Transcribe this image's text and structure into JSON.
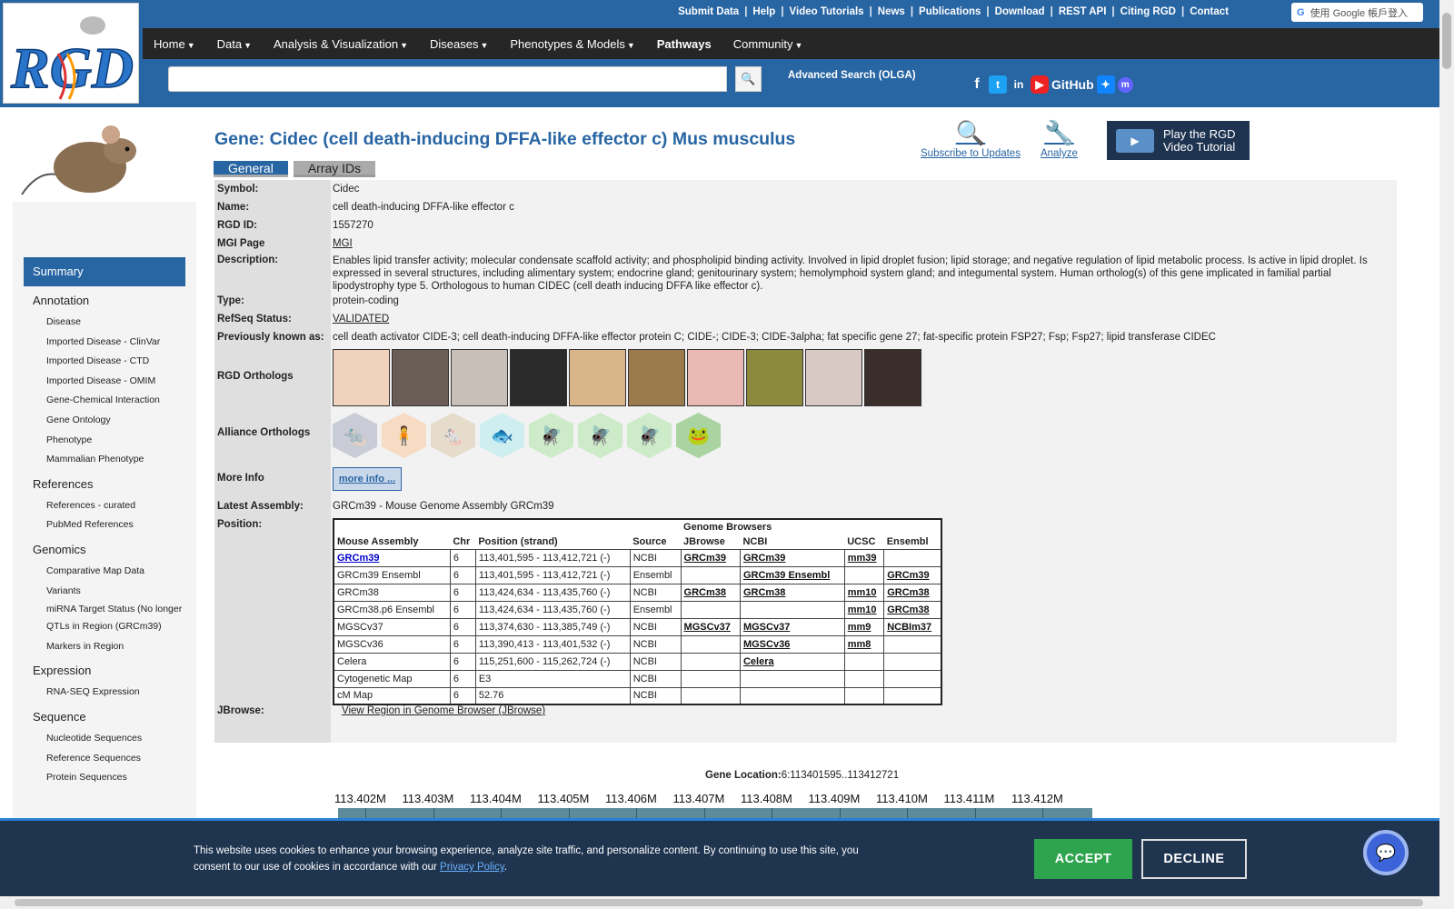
{
  "header": {
    "util_links": [
      "Submit Data",
      "Help",
      "Video Tutorials",
      "News",
      "Publications",
      "Download",
      "REST API",
      "Citing RGD",
      "Contact"
    ],
    "google_signin": "使用 Google 帳戶登入",
    "nav": [
      "Home",
      "Data",
      "Analysis & Visualization",
      "Diseases",
      "Phenotypes & Models",
      "Pathways",
      "Community"
    ],
    "search_placeholder": "",
    "advanced_search": "Advanced Search (OLGA)",
    "social": {
      "github": "GitHub"
    }
  },
  "sidebar": {
    "summary": "Summary",
    "sections": [
      {
        "title": "Annotation",
        "items": [
          "Disease",
          "Imported Disease - ClinVar",
          "Imported Disease - CTD",
          "Imported Disease - OMIM",
          "Gene-Chemical Interaction",
          "Gene Ontology",
          "Phenotype",
          "Mammalian Phenotype"
        ]
      },
      {
        "title": "References",
        "items": [
          "References - curated",
          "PubMed References"
        ]
      },
      {
        "title": "Genomics",
        "items": [
          "Comparative Map Data",
          "Variants",
          "miRNA Target Status (No longer",
          "QTLs in Region (GRCm39)",
          "Markers in Region"
        ]
      },
      {
        "title": "Expression",
        "items": [
          "RNA-SEQ Expression"
        ]
      },
      {
        "title": "Sequence",
        "items": [
          "Nucleotide Sequences",
          "Reference Sequences",
          "Protein Sequences"
        ]
      }
    ]
  },
  "gene": {
    "title": "Gene: Cidec (cell death-inducing DFFA-like effector c) Mus musculus",
    "subscribe": "Subscribe to Updates",
    "analyze": "Analyze",
    "video_line1": "Play the RGD",
    "video_line2": "Video Tutorial",
    "tabs": [
      "General",
      "Array IDs"
    ],
    "labels": {
      "symbol": "Symbol:",
      "name": "Name:",
      "rgd_id": "RGD ID:",
      "mgi": "MGI Page",
      "description": "Description:",
      "type": "Type:",
      "refseq": "RefSeq Status:",
      "prev": "Previously known as:",
      "rgd_orthologs": "RGD Orthologs",
      "alliance": "Alliance Orthologs",
      "more_info": "More Info",
      "latest": "Latest Assembly:",
      "position": "Position:",
      "jbrowse": "JBrowse:"
    },
    "symbol": "Cidec",
    "name": "cell death-inducing DFFA-like effector c",
    "rgd_id": "1557270",
    "mgi": "MGI",
    "description": "Enables lipid transfer activity; molecular condensate scaffold activity; and phospholipid binding activity. Involved in lipid droplet fusion; lipid storage; and negative regulation of lipid metabolic process. Is active in lipid droplet. Is expressed in several structures, including alimentary system; endocrine gland; genitourinary system; hemolymphoid system gland; and integumental system. Human ortholog(s) of this gene implicated in familial partial lipodystrophy type 5. Orthologous to human CIDEC (cell death inducing DFFA like effector c).",
    "type": "protein-coding",
    "refseq": "VALIDATED",
    "prev": "cell death activator CIDE-3; cell death-inducing DFFA-like effector protein C; CIDE-; CIDE-3; CIDE-3alpha; fat specific gene 27; fat-specific protein FSP27; Fsp; Fsp27; lipid transferase CIDEC",
    "more_info_btn": "more info ...",
    "latest": "GRCm39 - Mouse Genome Assembly GRCm39",
    "jbrowse_link": "View Region in Genome Browser (JBrowse)"
  },
  "position_table": {
    "header_group": "Genome Browsers",
    "columns": [
      "Mouse Assembly",
      "Chr",
      "Position (strand)",
      "Source",
      "JBrowse",
      "NCBI",
      "UCSC",
      "Ensembl"
    ],
    "rows": [
      [
        "GRCm39",
        "6",
        "113,401,595 - 113,412,721 (-)",
        "NCBI",
        "GRCm39",
        "GRCm39",
        "mm39",
        ""
      ],
      [
        "GRCm39 Ensembl",
        "6",
        "113,401,595 - 113,412,721 (-)",
        "Ensembl",
        "",
        "GRCm39 Ensembl",
        "",
        "GRCm39"
      ],
      [
        "GRCm38",
        "6",
        "113,424,634 - 113,435,760 (-)",
        "NCBI",
        "GRCm38",
        "GRCm38",
        "mm10",
        "GRCm38"
      ],
      [
        "GRCm38.p6 Ensembl",
        "6",
        "113,424,634 - 113,435,760 (-)",
        "Ensembl",
        "",
        "",
        "mm10",
        "GRCm38"
      ],
      [
        "MGSCv37",
        "6",
        "113,374,630 - 113,385,749 (-)",
        "NCBI",
        "MGSCv37",
        "MGSCv37",
        "mm9",
        "NCBIm37"
      ],
      [
        "MGSCv36",
        "6",
        "113,390,413 - 113,401,532 (-)",
        "NCBI",
        "",
        "MGSCv36",
        "mm8",
        ""
      ],
      [
        "Celera",
        "6",
        "115,251,600 - 115,262,724 (-)",
        "NCBI",
        "",
        "Celera",
        "",
        ""
      ],
      [
        "Cytogenetic Map",
        "6",
        "E3",
        "NCBI",
        "",
        "",
        "",
        ""
      ],
      [
        "cM Map",
        "6",
        "52.76",
        "NCBI",
        "",
        "",
        "",
        ""
      ]
    ]
  },
  "gene_location": {
    "label": "Gene Location:",
    "value": "6:113401595..113412721",
    "ticks": [
      "113.402M",
      "113.403M",
      "113.404M",
      "113.405M",
      "113.406M",
      "113.407M",
      "113.408M",
      "113.409M",
      "113.410M",
      "113.411M",
      "113.412M"
    ]
  },
  "cookie": {
    "text_before": "This website uses cookies to enhance your browsing experience, analyze site traffic, and personalize content. By continuing to use this site, you consent to our use of cookies in accordance with our ",
    "link": "Privacy Policy",
    "text_after": ".",
    "accept": "ACCEPT",
    "decline": "DECLINE"
  }
}
